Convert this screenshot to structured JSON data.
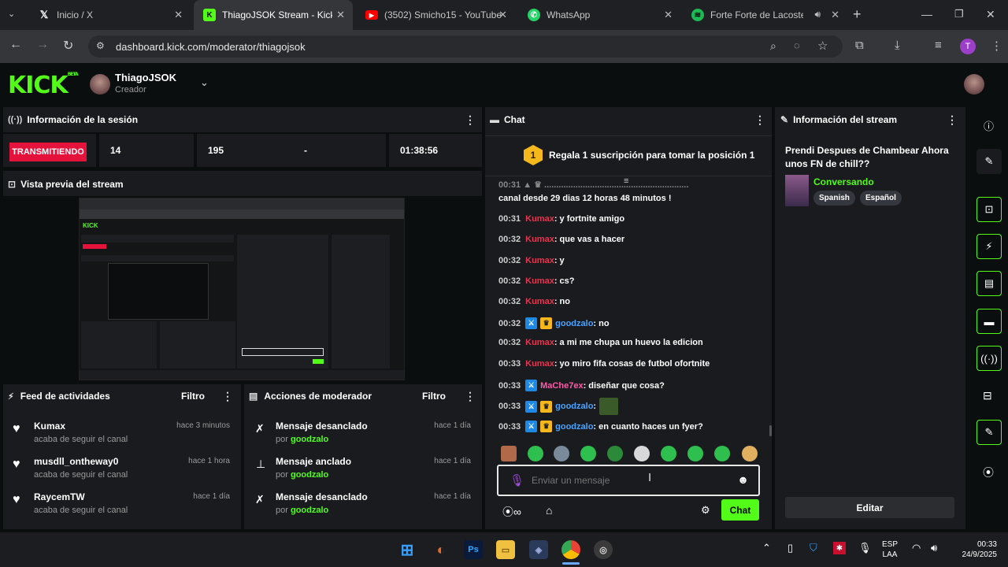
{
  "browser": {
    "tabs": [
      {
        "title": "Inicio / X",
        "icon": "x-logo-icon"
      },
      {
        "title": "ThiagoJSOK Stream - Kick D",
        "icon": "kick-logo-icon"
      },
      {
        "title": "(3502) Smicho15 - YouTube",
        "icon": "youtube-icon"
      },
      {
        "title": "WhatsApp",
        "icon": "whatsapp-icon"
      },
      {
        "title": "Forte Forte de Lacoste -",
        "icon": "spotify-icon"
      }
    ],
    "url": "dashboard.kick.com/moderator/thiagojsok",
    "profile_initial": "T"
  },
  "header": {
    "logo": "KICK",
    "logo_sup": "BETA",
    "channel_name": "ThiagoJSOK",
    "role": "Creador"
  },
  "session": {
    "title": "Información de la sesión",
    "status": "TRANSMITIENDO",
    "stats": [
      "14",
      "195",
      "-",
      "01:38:56"
    ]
  },
  "preview": {
    "title": "Vista previa del stream"
  },
  "feed": {
    "title": "Feed de actividades",
    "filter": "Filtro",
    "items": [
      {
        "name": "Kumax",
        "sub": "acaba de seguir el canal",
        "time": "hace 3 minutos"
      },
      {
        "name": "musdll_ontheway0",
        "sub": "acaba de seguir el canal",
        "time": "hace 1 hora"
      },
      {
        "name": "RaycemTW",
        "sub": "acaba de seguir el canal",
        "time": "hace 1 día"
      }
    ]
  },
  "mod_actions": {
    "title": "Acciones de moderador",
    "filter": "Filtro",
    "by_label": "por",
    "items": [
      {
        "action": "Mensaje desanclado",
        "by": "goodzalo",
        "time": "hace 1 día"
      },
      {
        "action": "Mensaje anclado",
        "by": "goodzalo",
        "time": "hace 1 día"
      },
      {
        "action": "Mensaje desanclado",
        "by": "goodzalo",
        "time": "hace 1 día"
      }
    ]
  },
  "chat": {
    "title": "Chat",
    "gift_banner": "Regala 1 suscripción para tomar la posición 1",
    "gift_rank": "1",
    "partial_line": "canal desde 29 dias 12 horas 48 minutos !",
    "messages": [
      {
        "ts": "00:31",
        "user": "Kumax",
        "color": "#e8344e",
        "text": ": y fortnite amigo",
        "badges": false
      },
      {
        "ts": "00:32",
        "user": "Kumax",
        "color": "#e8344e",
        "text": ": que vas a hacer",
        "badges": false
      },
      {
        "ts": "00:32",
        "user": "Kumax",
        "color": "#e8344e",
        "text": ": y",
        "badges": false
      },
      {
        "ts": "00:32",
        "user": "Kumax",
        "color": "#e8344e",
        "text": ": cs?",
        "badges": false
      },
      {
        "ts": "00:32",
        "user": "Kumax",
        "color": "#e8344e",
        "text": ": no",
        "badges": false
      },
      {
        "ts": "00:32",
        "user": "goodzalo",
        "color": "#4aa3ff",
        "text": ": no",
        "badges": true
      },
      {
        "ts": "00:32",
        "user": "Kumax",
        "color": "#e8344e",
        "text": ": a mi me chupa un huevo la edicion",
        "badges": false
      },
      {
        "ts": "00:33",
        "user": "Kumax",
        "color": "#e8344e",
        "text": ": yo miro fifa cosas de futbol ofortnite",
        "badges": false
      },
      {
        "ts": "00:33",
        "user": "MaChe7ex",
        "color": "#ff5aa8",
        "text": ": diseñar que cosa?",
        "badges": "one"
      },
      {
        "ts": "00:33",
        "user": "goodzalo",
        "color": "#4aa3ff",
        "text": ":",
        "badges": true
      },
      {
        "ts": "00:33",
        "user": "goodzalo",
        "color": "#4aa3ff",
        "text": ": en cuanto haces un fyer?",
        "badges": true
      }
    ],
    "input_placeholder": "Enviar un mensaje",
    "send_label": "Chat"
  },
  "stream_info": {
    "title": "Información del stream",
    "stream_title": "Prendi Despues de Chambear Ahora unos FN de chill??",
    "category": "Conversando",
    "tags": [
      "Spanish",
      "Español"
    ],
    "edit_label": "Editar"
  },
  "taskbar": {
    "lang_top": "ESP",
    "lang_bottom": "LAA",
    "time": "00:33",
    "date": "24/9/2025"
  }
}
